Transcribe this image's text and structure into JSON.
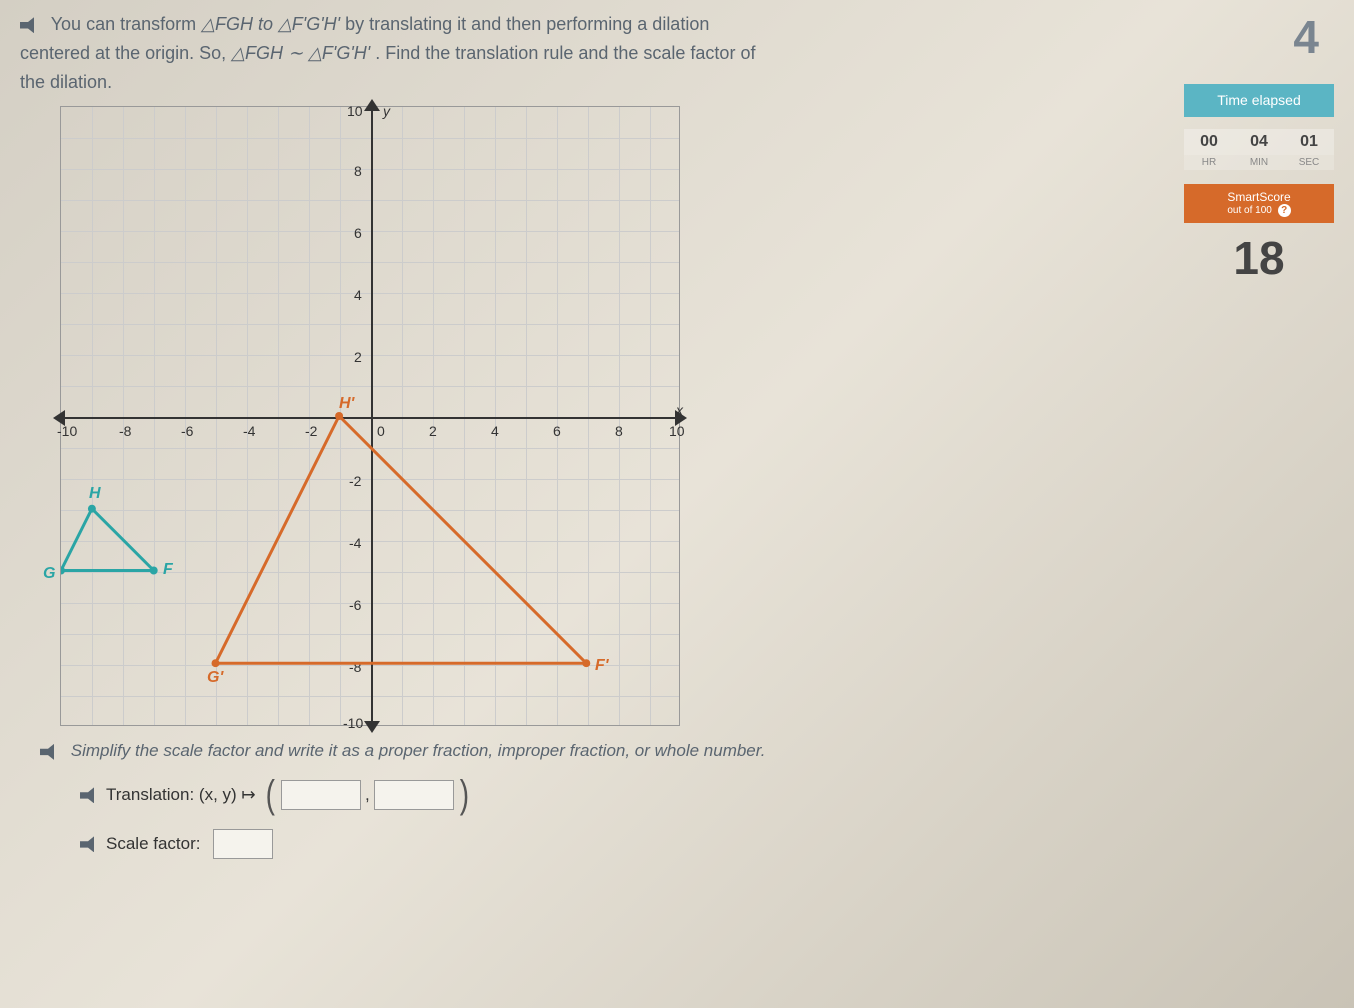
{
  "question": {
    "line1_prefix": "You can transform ",
    "line1_tri1": "△FGH to △F'G'H'",
    "line1_mid": " by translating it and then performing a dilation",
    "line2_prefix": "centered at the origin. So, ",
    "line2_sim": "△FGH ∼ △F'G'H'",
    "line2_suffix": ". Find the translation rule and the scale factor of",
    "line3": "the dilation."
  },
  "instruction": "Simplify the scale factor and write it as a proper fraction, improper fraction, or whole number.",
  "answers": {
    "translation_label": "Translation: (x, y) ↦",
    "scale_label": "Scale factor:"
  },
  "sidebar": {
    "question_num": "4",
    "time_title": "Time elapsed",
    "time": {
      "hr": "00",
      "min": "04",
      "sec": "01"
    },
    "time_units": {
      "hr": "HR",
      "min": "MIN",
      "sec": "SEC"
    },
    "smartscore_title": "SmartScore",
    "smartscore_sub": "out of 100",
    "score": "18"
  },
  "axis": {
    "y_label": "y",
    "x_label": "x",
    "origin": "0",
    "xticks": [
      "-10",
      "-8",
      "-6",
      "-4",
      "-2",
      "2",
      "4",
      "6",
      "8",
      "10"
    ],
    "yticks_pos": [
      "10",
      "8",
      "6",
      "4",
      "2"
    ],
    "yticks_neg": [
      "-2",
      "-4",
      "-6",
      "-8",
      "-10"
    ]
  },
  "vertices": {
    "H": "H",
    "G": "G",
    "F": "F",
    "Hp": "H'",
    "Gp": "G'",
    "Fp": "F'"
  },
  "chart_data": {
    "type": "scatter",
    "title": "",
    "xlabel": "x",
    "ylabel": "y",
    "xlim": [
      -10,
      10
    ],
    "ylim": [
      -10,
      10
    ],
    "series": [
      {
        "name": "Triangle FGH",
        "color": "#2aa5a5",
        "points": [
          {
            "label": "G",
            "x": -10,
            "y": -5
          },
          {
            "label": "F",
            "x": -7,
            "y": -5
          },
          {
            "label": "H",
            "x": -9,
            "y": -3
          }
        ]
      },
      {
        "name": "Triangle F'G'H'",
        "color": "#d66a2a",
        "points": [
          {
            "label": "G'",
            "x": -5,
            "y": -8
          },
          {
            "label": "F'",
            "x": 7,
            "y": -8
          },
          {
            "label": "H'",
            "x": -1,
            "y": 0
          }
        ]
      }
    ]
  }
}
